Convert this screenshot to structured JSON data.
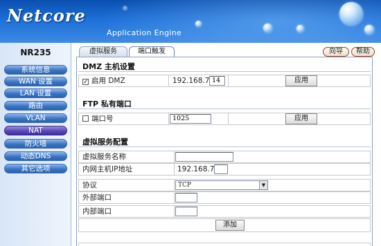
{
  "header": {
    "logo": "Netcore",
    "registered": "®",
    "tagline": "Application Engine"
  },
  "sidebar": {
    "model": "NR235",
    "items": [
      {
        "label": "系统信息"
      },
      {
        "label": "WAN 设置"
      },
      {
        "label": "LAN 设置"
      },
      {
        "label": "路由"
      },
      {
        "label": "VLAN"
      },
      {
        "label": "NAT",
        "active": true
      },
      {
        "label": "防火墙"
      },
      {
        "label": "动态DNS"
      },
      {
        "label": "其它选项"
      }
    ]
  },
  "tabs": [
    {
      "label": "虚拟服务",
      "active": false
    },
    {
      "label": "端口触发",
      "active": true
    }
  ],
  "top_buttons": {
    "wizard": "向导",
    "help": "帮助"
  },
  "dmz": {
    "title": "DMZ 主机设置",
    "checkbox_checked": true,
    "checkbox_mark": "✓",
    "label": "启用  DMZ",
    "ip_prefix": "192.168.7.",
    "ip_last": "14",
    "apply": "应用"
  },
  "ftp": {
    "title": "FTP 私有端口",
    "checkbox_checked": false,
    "label": "端口号",
    "port": "1025",
    "apply": "应用"
  },
  "virtual_server": {
    "title": "虚拟服务配置",
    "name_label": "虚拟服务名称",
    "name_value": "",
    "ip_label": "内网主机IP地址",
    "ip_prefix": "192.168.7.",
    "ip_last": "",
    "protocol_label": "协议",
    "protocol_value": "TCP",
    "ext_port_label": "外部端口",
    "ext_port_value": "",
    "int_port_label": "内部端口",
    "int_port_value": "",
    "add": "添加"
  },
  "colors": {
    "header_blue": "#1c6fd6",
    "nav_blue": "#3a74c4",
    "nav_active_purple": "#5a48b8"
  }
}
